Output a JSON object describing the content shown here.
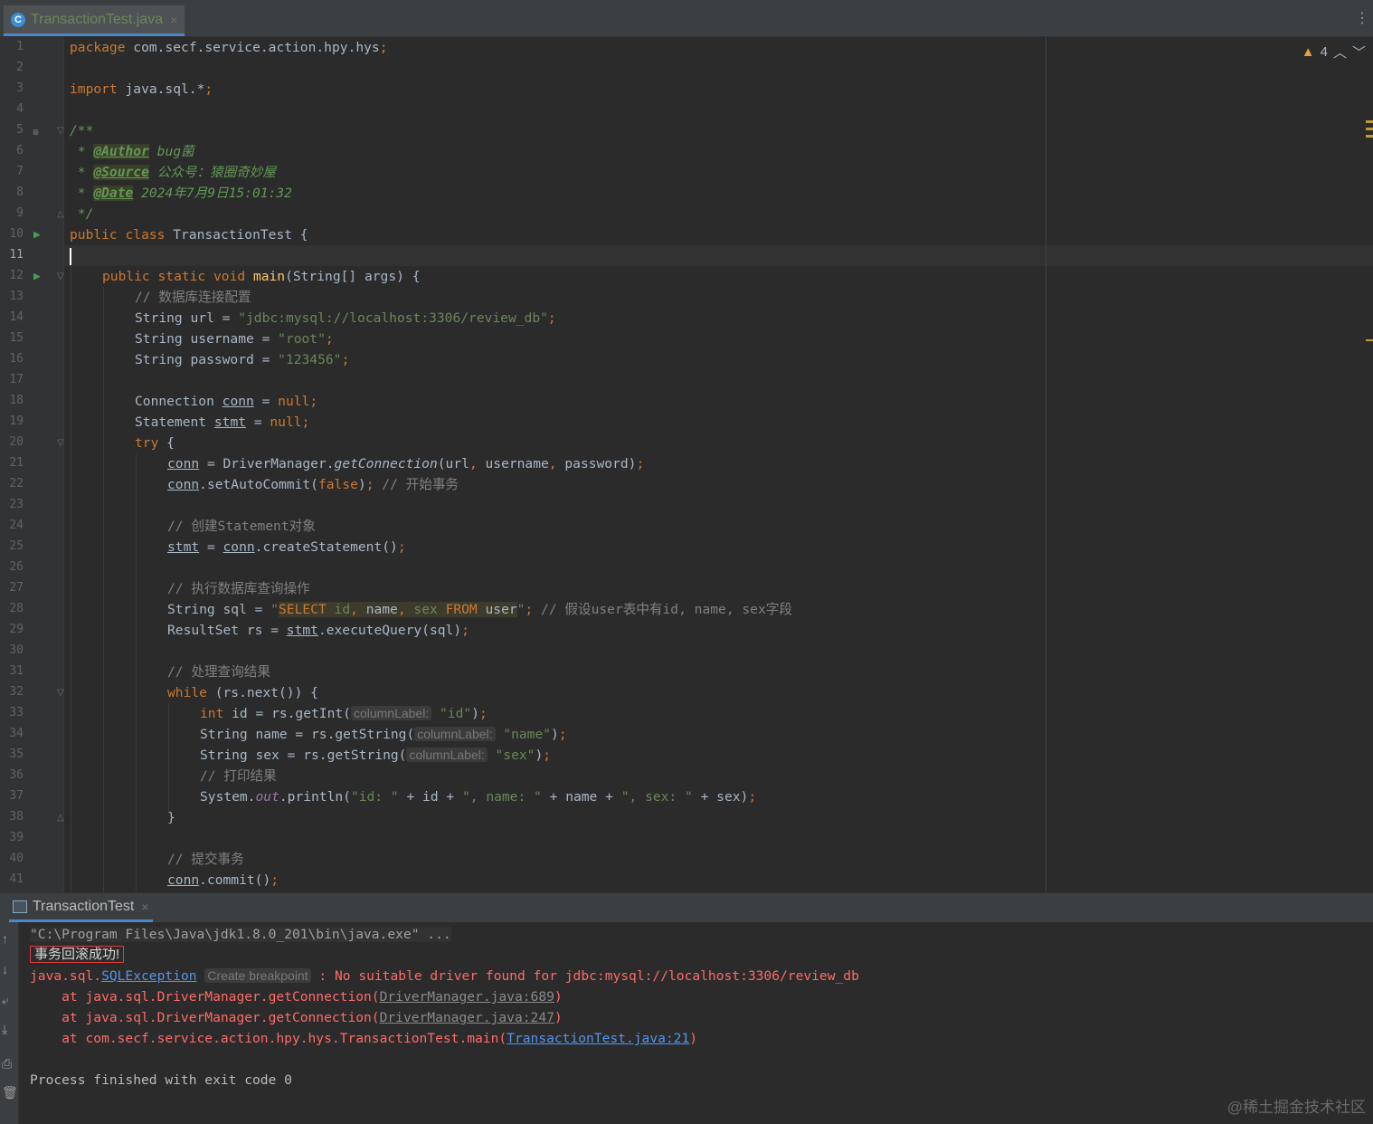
{
  "tab": {
    "icon": "class-icon",
    "label": "TransactionTest.java",
    "close": "×"
  },
  "inspections": {
    "warning_count": "4"
  },
  "editor": {
    "line_numbers": [
      "1",
      "2",
      "3",
      "4",
      "5",
      "6",
      "7",
      "8",
      "9",
      "10",
      "11",
      "12",
      "13",
      "14",
      "15",
      "16",
      "17",
      "18",
      "19",
      "20",
      "21",
      "22",
      "23",
      "24",
      "25",
      "26",
      "27",
      "28",
      "29",
      "30",
      "31",
      "32",
      "33",
      "34",
      "35",
      "36",
      "37",
      "38",
      "39",
      "40",
      "41"
    ],
    "current_line": "11",
    "code": {
      "l1_kw": "package",
      "l1_rest": " com.secf.service.action.hpy.hys",
      "l1_semi": ";",
      "l3_kw": "import",
      "l3_rest": " java.sql.*",
      "l3_semi": ";",
      "l5": "/**",
      "l6_star": " * ",
      "l6_tag": "@Author",
      "l6_text": " bug菌",
      "l7_star": " * ",
      "l7_tag": "@Source",
      "l7_text": " 公众号：猿圈奇妙屋",
      "l8_star": " * ",
      "l8_tag": "@Date",
      "l8_text": " 2024年7月9日15:01:32",
      "l9": " */",
      "l10_kw": "public class",
      "l10_rest": " TransactionTest {",
      "l12_kw": "public static void",
      "l12_fn": "main",
      "l12_rest": "(String[] args) {",
      "l13": "// 数据库连接配置",
      "l14_a": "String url = ",
      "l14_str": "\"jdbc:mysql://localhost:3306/review_db\"",
      "l14_semi": ";",
      "l15_a": "String username = ",
      "l15_str": "\"root\"",
      "l15_semi": ";",
      "l16_a": "String password = ",
      "l16_str": "\"123456\"",
      "l16_semi": ";",
      "l18_a": "Connection ",
      "l18_var": "conn",
      "l18_b": " = ",
      "l18_kw": "null",
      "l18_semi": ";",
      "l19_a": "Statement ",
      "l19_var": "stmt",
      "l19_b": " = ",
      "l19_kw": "null",
      "l19_semi": ";",
      "l20_kw": "try",
      "l20_rest": " {",
      "l21_var": "conn",
      "l21_a": " = DriverManager.",
      "l21_it": "getConnection",
      "l21_b": "(url",
      "l21_c1": ",",
      "l21_c": " username",
      "l21_c2": ",",
      "l21_d": " password)",
      "l21_semi": ";",
      "l22_var": "conn",
      "l22_a": ".setAutoCommit(",
      "l22_kw": "false",
      "l22_b": ")",
      "l22_semi": ";",
      "l22_cm": " // 开始事务",
      "l24": "// 创建Statement对象",
      "l25_var": "stmt",
      "l25_a": " = ",
      "l25_var2": "conn",
      "l25_b": ".createStatement()",
      "l25_semi": ";",
      "l27": "// 执行数据库查询操作",
      "l28_a": "String sql = ",
      "l28_q1": "\"",
      "l28_sel": "SELECT",
      "l28_id": " id",
      "l28_c1": ",",
      "l28_name": " name",
      "l28_c2": ",",
      "l28_sex": " sex ",
      "l28_from": "FROM",
      "l28_user": " user",
      "l28_q2": "\"",
      "l28_semi": ";",
      "l28_cm": " // 假设user表中有id, name, sex字段",
      "l29_a": "ResultSet rs = ",
      "l29_var": "stmt",
      "l29_b": ".executeQuery(sql)",
      "l29_semi": ";",
      "l31": "// 处理查询结果",
      "l32_kw": "while",
      "l32_rest": " (rs.next()) {",
      "l33_kw": "int",
      "l33_a": " id = rs.getInt(",
      "l33_hint": "columnLabel:",
      "l33_str": " \"id\"",
      "l33_b": ")",
      "l33_semi": ";",
      "l34_a": "String name = rs.getString(",
      "l34_hint": "columnLabel:",
      "l34_str": " \"name\"",
      "l34_b": ")",
      "l34_semi": ";",
      "l35_a": "String sex = rs.getString(",
      "l35_hint": "columnLabel:",
      "l35_str": " \"sex\"",
      "l35_b": ")",
      "l35_semi": ";",
      "l36": "// 打印结果",
      "l37_a": "System.",
      "l37_out": "out",
      "l37_b": ".println(",
      "l37_s1": "\"id: \"",
      "l37_c": " + id + ",
      "l37_s2": "\", name: \"",
      "l37_d": " + name + ",
      "l37_s3": "\", sex: \"",
      "l37_e": " + sex)",
      "l37_semi": ";",
      "l38": "}",
      "l40": "// 提交事务",
      "l41_var": "conn",
      "l41_a": ".commit()",
      "l41_semi": ";"
    }
  },
  "run_panel": {
    "tab_label": "TransactionTest",
    "close": "×",
    "tools": [
      "up-arrow-icon",
      "down-arrow-icon",
      "soft-wrap-icon",
      "scroll-to-end-icon",
      "print-icon",
      "trash-icon"
    ],
    "console": {
      "cmd": "\"C:\\Program Files\\Java\\jdk1.8.0_201\\bin\\java.exe\" ...",
      "success": "事务回滚成功!",
      "exc_a": "java.sql.",
      "exc_link": "SQLException",
      "exc_hint": "Create breakpoint",
      "exc_msg": " : No suitable driver found for jdbc:mysql://localhost:3306/review_db",
      "st1_a": "    at java.sql.DriverManager.getConnection(",
      "st1_link": "DriverManager.java:689",
      "st1_b": ")",
      "st2_a": "    at java.sql.DriverManager.getConnection(",
      "st2_link": "DriverManager.java:247",
      "st2_b": ")",
      "st3_a": "    at com.secf.service.action.hpy.hys.TransactionTest.main(",
      "st3_link": "TransactionTest.java:21",
      "st3_b": ")",
      "exit": "Process finished with exit code 0"
    }
  },
  "watermark": "@稀土掘金技术社区",
  "colors": {
    "background": "#2b2b2b",
    "keyword": "#cc7832",
    "string": "#6a8759",
    "error": "#ff6b68",
    "link": "#5394ec"
  }
}
